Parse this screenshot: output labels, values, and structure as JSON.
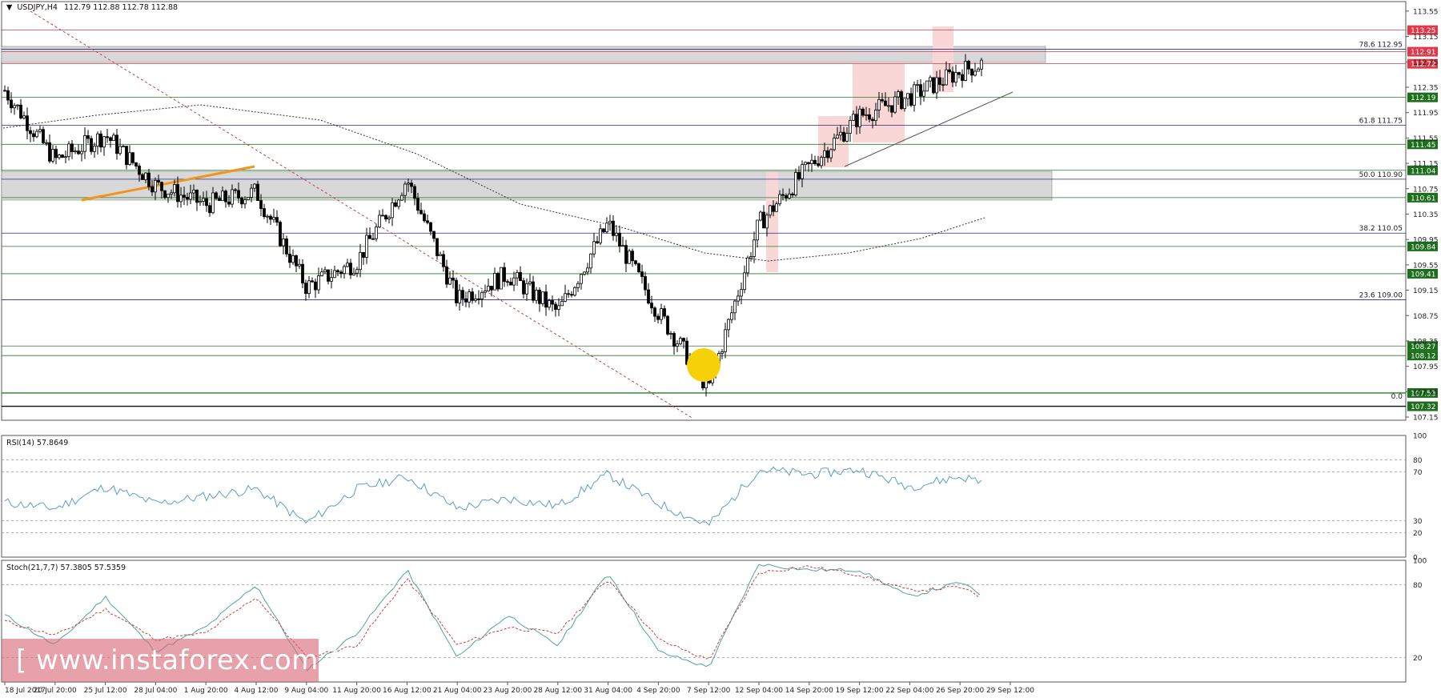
{
  "header": {
    "symbol": "USDJPY,H4",
    "ohlc": "112.79 112.88 112.78 112.88"
  },
  "price_scale": [
    "113.55",
    "113.15",
    "112.75",
    "112.35",
    "111.95",
    "111.55",
    "111.15",
    "110.75",
    "110.35",
    "109.95",
    "109.55",
    "109.15",
    "108.75",
    "108.35",
    "107.95",
    "107.55",
    "107.15"
  ],
  "level_labels": [
    {
      "price": 113.25,
      "text": "113.25",
      "color": "#e03a48"
    },
    {
      "price": 112.91,
      "text": "112.91",
      "color": "#e03a48"
    },
    {
      "price": 112.72,
      "text": "112.72",
      "color": "#e03a48"
    },
    {
      "price": 112.19,
      "text": "112.19",
      "color": "#1d6e1d"
    },
    {
      "price": 111.45,
      "text": "111.45",
      "color": "#1d6e1d"
    },
    {
      "price": 111.04,
      "text": "111.04",
      "color": "#1d6e1d"
    },
    {
      "price": 110.61,
      "text": "110.61",
      "color": "#1d6e1d"
    },
    {
      "price": 109.84,
      "text": "109.84",
      "color": "#1d6e1d"
    },
    {
      "price": 109.41,
      "text": "109.41",
      "color": "#1d6e1d"
    },
    {
      "price": 108.27,
      "text": "108.27",
      "color": "#1d6e1d"
    },
    {
      "price": 108.12,
      "text": "108.12",
      "color": "#1d6e1d"
    },
    {
      "price": 107.53,
      "text": "107.53",
      "color": "#1d6e1d"
    },
    {
      "price": 107.32,
      "text": "107.32",
      "color": "#1d6e1d"
    }
  ],
  "fib_labels": [
    {
      "price": 112.95,
      "text": "78.6 112.95"
    },
    {
      "price": 111.75,
      "text": "61.8 111.75"
    },
    {
      "price": 110.9,
      "text": "50.0 110.90"
    },
    {
      "price": 110.05,
      "text": "38.2 110.05"
    },
    {
      "price": 109.0,
      "text": "23.6 109.00"
    },
    {
      "price": 107.4,
      "text": "0.0"
    }
  ],
  "rsi": {
    "label": "RSI(14) 57.8649",
    "scale": [
      "100",
      "80",
      "70",
      "30",
      "20",
      "0"
    ]
  },
  "stoch": {
    "label": "Stoch(21,7,7) 57.3805 57.5359",
    "scale": [
      "100",
      "80",
      "20"
    ]
  },
  "time_axis": [
    "18 Jul 2017",
    "20 Jul 20:00",
    "25 Jul 12:00",
    "28 Jul 04:00",
    "1 Aug 20:00",
    "4 Aug 12:00",
    "9 Aug 04:00",
    "11 Aug 20:00",
    "16 Aug 12:00",
    "21 Aug 04:00",
    "23 Aug 20:00",
    "28 Aug 12:00",
    "31 Aug 04:00",
    "4 Sep 20:00",
    "7 Sep 12:00",
    "12 Sep 04:00",
    "14 Sep 20:00",
    "19 Sep 12:00",
    "22 Sep 04:00",
    "26 Sep 20:00",
    "29 Sep 12:00"
  ],
  "watermark": "[ www.instaforex.com ]",
  "chart_data": {
    "type": "candlestick",
    "symbol": "USDJPY",
    "timeframe": "H4",
    "ylim": [
      107.1,
      113.7
    ],
    "close_path": [
      {
        "x": "18 Jul 2017",
        "y": 112.3
      },
      {
        "x": "20 Jul 20:00",
        "y": 111.2
      },
      {
        "x": "25 Jul 12:00",
        "y": 111.6
      },
      {
        "x": "28 Jul 04:00",
        "y": 110.8
      },
      {
        "x": "1 Aug 20:00",
        "y": 110.5
      },
      {
        "x": "4 Aug 12:00",
        "y": 110.7
      },
      {
        "x": "9 Aug 04:00",
        "y": 109.2
      },
      {
        "x": "11 Aug 20:00",
        "y": 109.6
      },
      {
        "x": "16 Aug 12:00",
        "y": 110.9
      },
      {
        "x": "21 Aug 04:00",
        "y": 109.0
      },
      {
        "x": "23 Aug 20:00",
        "y": 109.4
      },
      {
        "x": "28 Aug 12:00",
        "y": 108.8
      },
      {
        "x": "31 Aug 04:00",
        "y": 110.2
      },
      {
        "x": "4 Sep 20:00",
        "y": 108.8
      },
      {
        "x": "7 Sep 12:00",
        "y": 107.6
      },
      {
        "x": "12 Sep 04:00",
        "y": 110.2
      },
      {
        "x": "14 Sep 20:00",
        "y": 111.1
      },
      {
        "x": "19 Sep 12:00",
        "y": 111.9
      },
      {
        "x": "22 Sep 04:00",
        "y": 112.2
      },
      {
        "x": "26 Sep 20:00",
        "y": 112.6
      },
      {
        "x": "29 Sep 12:00",
        "y": 112.88
      }
    ],
    "rsi_path": [
      {
        "x": "18 Jul 2017",
        "y": 45
      },
      {
        "x": "20 Jul 20:00",
        "y": 40
      },
      {
        "x": "25 Jul 12:00",
        "y": 58
      },
      {
        "x": "28 Jul 04:00",
        "y": 44
      },
      {
        "x": "1 Aug 20:00",
        "y": 50
      },
      {
        "x": "4 Aug 12:00",
        "y": 56
      },
      {
        "x": "9 Aug 04:00",
        "y": 28
      },
      {
        "x": "11 Aug 20:00",
        "y": 56
      },
      {
        "x": "16 Aug 12:00",
        "y": 66
      },
      {
        "x": "21 Aug 04:00",
        "y": 40
      },
      {
        "x": "23 Aug 20:00",
        "y": 48
      },
      {
        "x": "28 Aug 12:00",
        "y": 42
      },
      {
        "x": "31 Aug 04:00",
        "y": 68
      },
      {
        "x": "4 Sep 20:00",
        "y": 44
      },
      {
        "x": "7 Sep 12:00",
        "y": 26
      },
      {
        "x": "12 Sep 04:00",
        "y": 72
      },
      {
        "x": "14 Sep 20:00",
        "y": 68
      },
      {
        "x": "19 Sep 12:00",
        "y": 72
      },
      {
        "x": "22 Sep 04:00",
        "y": 58
      },
      {
        "x": "26 Sep 20:00",
        "y": 66
      },
      {
        "x": "29 Sep 12:00",
        "y": 57.9
      }
    ],
    "stoch_k": [
      {
        "x": "18 Jul 2017",
        "y": 55
      },
      {
        "x": "20 Jul 20:00",
        "y": 30
      },
      {
        "x": "25 Jul 12:00",
        "y": 70
      },
      {
        "x": "28 Jul 04:00",
        "y": 25
      },
      {
        "x": "1 Aug 20:00",
        "y": 45
      },
      {
        "x": "4 Aug 12:00",
        "y": 80
      },
      {
        "x": "9 Aug 04:00",
        "y": 10
      },
      {
        "x": "11 Aug 20:00",
        "y": 40
      },
      {
        "x": "16 Aug 12:00",
        "y": 92
      },
      {
        "x": "21 Aug 04:00",
        "y": 20
      },
      {
        "x": "23 Aug 20:00",
        "y": 55
      },
      {
        "x": "28 Aug 12:00",
        "y": 30
      },
      {
        "x": "31 Aug 04:00",
        "y": 90
      },
      {
        "x": "4 Sep 20:00",
        "y": 25
      },
      {
        "x": "7 Sep 12:00",
        "y": 12
      },
      {
        "x": "12 Sep 04:00",
        "y": 97
      },
      {
        "x": "14 Sep 20:00",
        "y": 92
      },
      {
        "x": "19 Sep 12:00",
        "y": 92
      },
      {
        "x": "22 Sep 04:00",
        "y": 70
      },
      {
        "x": "26 Sep 20:00",
        "y": 82
      },
      {
        "x": "29 Sep 12:00",
        "y": 57.4
      }
    ],
    "stoch_d": [
      {
        "x": "18 Jul 2017",
        "y": 50
      },
      {
        "x": "20 Jul 20:00",
        "y": 38
      },
      {
        "x": "25 Jul 12:00",
        "y": 60
      },
      {
        "x": "28 Jul 04:00",
        "y": 35
      },
      {
        "x": "1 Aug 20:00",
        "y": 40
      },
      {
        "x": "4 Aug 12:00",
        "y": 70
      },
      {
        "x": "9 Aug 04:00",
        "y": 20
      },
      {
        "x": "11 Aug 20:00",
        "y": 30
      },
      {
        "x": "16 Aug 12:00",
        "y": 85
      },
      {
        "x": "21 Aug 04:00",
        "y": 30
      },
      {
        "x": "23 Aug 20:00",
        "y": 45
      },
      {
        "x": "28 Aug 12:00",
        "y": 40
      },
      {
        "x": "31 Aug 04:00",
        "y": 85
      },
      {
        "x": "4 Sep 20:00",
        "y": 35
      },
      {
        "x": "7 Sep 12:00",
        "y": 18
      },
      {
        "x": "12 Sep 04:00",
        "y": 90
      },
      {
        "x": "14 Sep 20:00",
        "y": 95
      },
      {
        "x": "19 Sep 12:00",
        "y": 88
      },
      {
        "x": "22 Sep 04:00",
        "y": 75
      },
      {
        "x": "26 Sep 20:00",
        "y": 78
      },
      {
        "x": "29 Sep 12:00",
        "y": 57.5
      }
    ]
  }
}
